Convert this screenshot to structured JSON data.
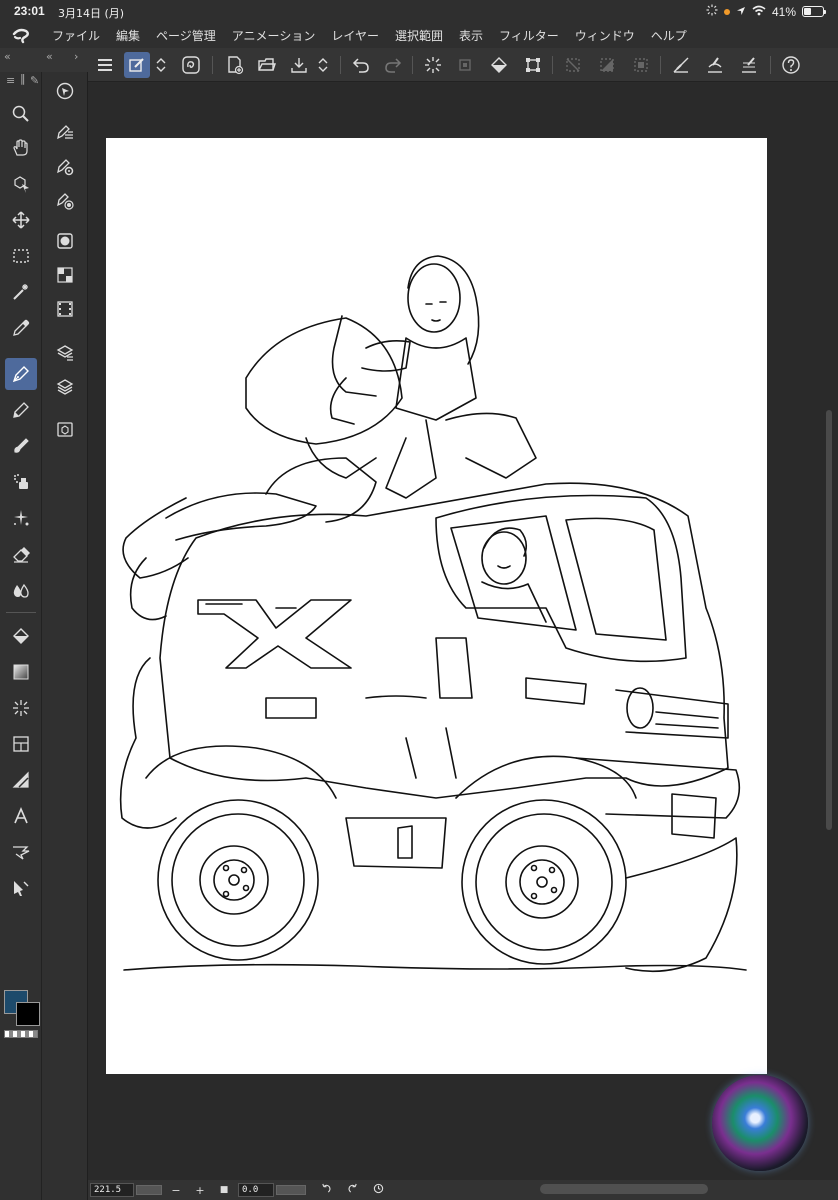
{
  "status_bar": {
    "time": "23:01",
    "date": "3月14日 (月)",
    "battery": "41%",
    "battery_level": 0.41
  },
  "menu": {
    "items": [
      "ファイル",
      "編集",
      "ページ管理",
      "アニメーション",
      "レイヤー",
      "選択範囲",
      "表示",
      "フィルター",
      "ウィンドウ",
      "ヘルプ"
    ]
  },
  "command_bar": {
    "icons": [
      "menu-icon",
      "canvas-settings-icon",
      "up-down-icon",
      "app-settings-icon",
      "new-canvas-icon",
      "open-folder-icon",
      "save-icon",
      "up-down-icon",
      "undo-icon",
      "redo-icon",
      "loading-icon",
      "clear-icon",
      "fill-icon",
      "transform-icon",
      "deselect-icon",
      "invert-selection-icon",
      "show-selection-icon",
      "ruler-snap-icon",
      "special-ruler-icon",
      "grid-snap-icon",
      "help-icon"
    ]
  },
  "tools": {
    "items": [
      "zoom-icon",
      "hand-icon",
      "object-select-icon",
      "move-icon",
      "selection-icon",
      "auto-select-icon",
      "eyedropper-icon",
      "pen-icon",
      "pencil-icon",
      "brush-icon",
      "airbrush-icon",
      "decoration-icon",
      "eraser-icon",
      "blend-icon",
      "fill-icon",
      "gradient-icon",
      "figure-icon",
      "frame-icon",
      "ruler-icon",
      "text-icon",
      "balloon-icon",
      "correct-line-icon"
    ],
    "active": "pen-icon",
    "main_color": "#1d4a6b",
    "sub_color": "#000000"
  },
  "navigator": {
    "zoom": "221.5",
    "rotation": "0.0",
    "minus": "−",
    "plus": "+",
    "stop": "■"
  }
}
